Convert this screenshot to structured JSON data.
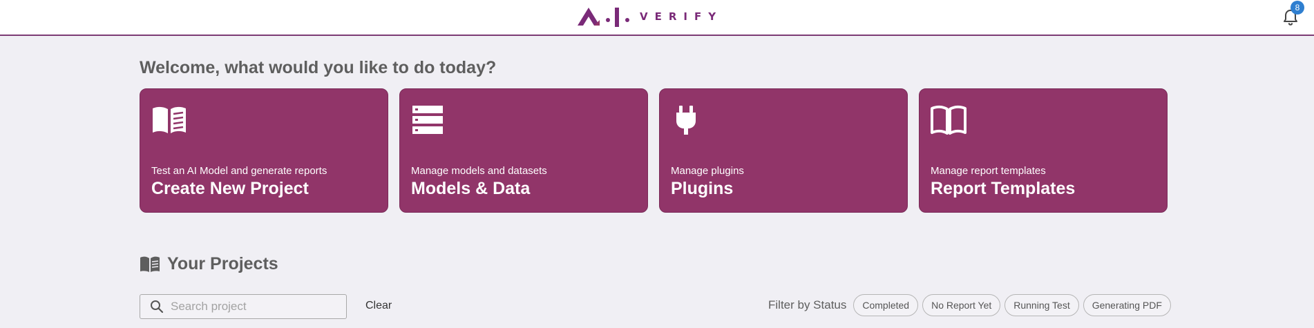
{
  "header": {
    "logo_text": "VERIFY",
    "logo_prefix": "A·I",
    "notification_count": "8",
    "brand_color": "#7a2a78"
  },
  "welcome": {
    "heading": "Welcome, what would you like to do today?"
  },
  "cards": [
    {
      "subtitle": "Test an AI Model and generate reports",
      "title": "Create New Project",
      "icon": "book-report-icon"
    },
    {
      "subtitle": "Manage models and datasets",
      "title": "Models & Data",
      "icon": "server-stack-icon"
    },
    {
      "subtitle": "Manage plugins",
      "title": "Plugins",
      "icon": "plug-icon"
    },
    {
      "subtitle": "Manage report templates",
      "title": "Report Templates",
      "icon": "open-book-icon"
    }
  ],
  "card_color": "#913569",
  "projects": {
    "heading": "Your Projects",
    "search_placeholder": "Search project",
    "search_value": "",
    "clear_label": "Clear",
    "filter_label": "Filter by Status",
    "filters": [
      "Completed",
      "No Report Yet",
      "Running Test",
      "Generating PDF"
    ]
  }
}
